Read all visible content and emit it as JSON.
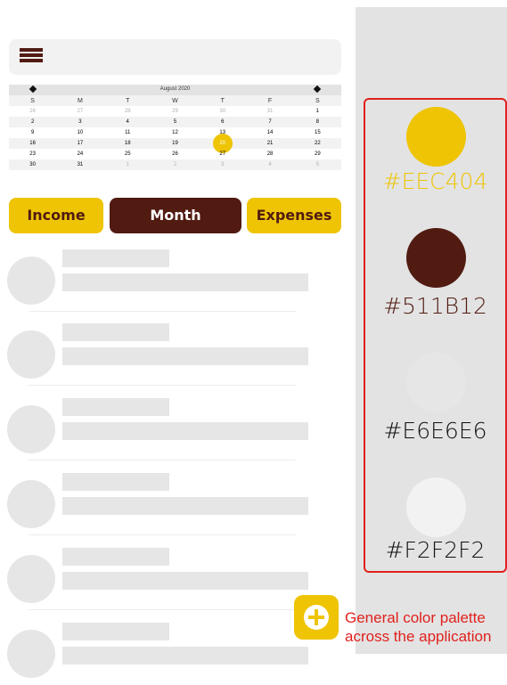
{
  "calendar": {
    "month_label": "August 2020",
    "weekdays": [
      "S",
      "M",
      "T",
      "W",
      "T",
      "F",
      "S"
    ],
    "weeks": [
      [
        "26",
        "27",
        "28",
        "29",
        "30",
        "31",
        "1"
      ],
      [
        "2",
        "3",
        "4",
        "5",
        "6",
        "7",
        "8"
      ],
      [
        "9",
        "10",
        "11",
        "12",
        "13",
        "14",
        "15"
      ],
      [
        "16",
        "17",
        "18",
        "19",
        "20",
        "21",
        "22"
      ],
      [
        "23",
        "24",
        "25",
        "26",
        "27",
        "28",
        "29"
      ],
      [
        "30",
        "31",
        "1",
        "2",
        "3",
        "4",
        "5"
      ]
    ],
    "selected_day": "20"
  },
  "tabs": {
    "income": "Income",
    "month": "Month",
    "expenses": "Expenses"
  },
  "palette": {
    "colors": [
      {
        "code": "#EEC404",
        "hex": "#eec404"
      },
      {
        "code": "#511B12",
        "hex": "#511b12"
      },
      {
        "code": "#E6E6E6",
        "hex": "#e6e6e6"
      },
      {
        "code": "#F2F2F2",
        "hex": "#f2f2f2"
      }
    ],
    "caption": "General color palette across the application"
  },
  "icons": {
    "menu": "hamburger-menu-icon",
    "add": "plus-icon",
    "prev": "diamond-arrow-icon",
    "next": "diamond-arrow-icon"
  }
}
